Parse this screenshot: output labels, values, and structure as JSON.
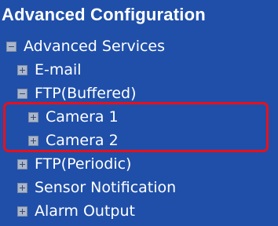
{
  "panel": {
    "title": "Advanced Configuration",
    "tree": {
      "root": {
        "label": "Advanced Services",
        "state": "expanded"
      },
      "items": [
        {
          "label": "E-mail",
          "state": "collapsed"
        },
        {
          "label": "FTP(Buffered)",
          "state": "expanded"
        },
        {
          "label": "Camera 1",
          "state": "collapsed"
        },
        {
          "label": "Camera 2",
          "state": "collapsed"
        },
        {
          "label": "FTP(Periodic)",
          "state": "collapsed"
        },
        {
          "label": "Sensor Notification",
          "state": "collapsed"
        },
        {
          "label": "Alarm Output",
          "state": "collapsed"
        }
      ]
    }
  },
  "icons": {
    "expanded": "minus-toggle-icon",
    "collapsed": "plus-toggle-icon"
  },
  "colors": {
    "background": "#1f4fa9",
    "text": "#ffffff",
    "toggle": "#aab6cb",
    "highlight": "#e8101c"
  }
}
